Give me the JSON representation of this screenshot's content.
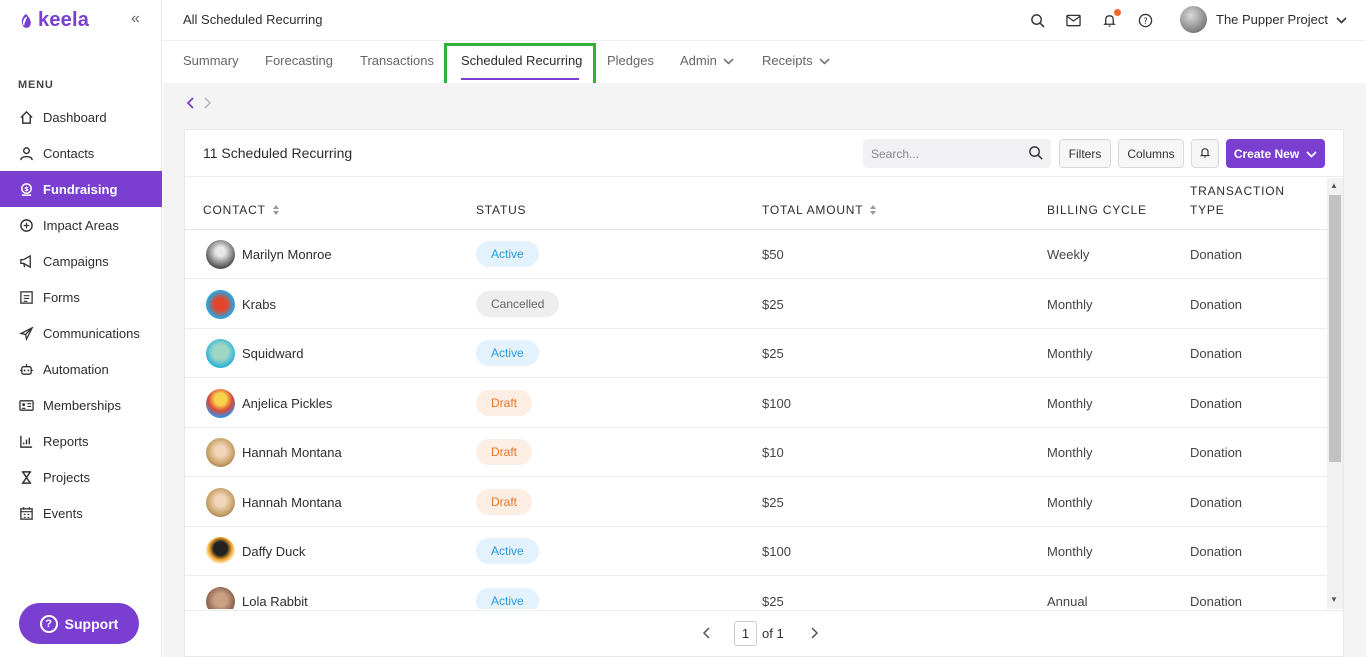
{
  "app": {
    "logo_text": "keela",
    "accent": "#7a3fd1"
  },
  "sidebar": {
    "menu_title": "MENU",
    "items": [
      {
        "label": "Dashboard",
        "icon": "home-icon",
        "active": false
      },
      {
        "label": "Contacts",
        "icon": "user-icon",
        "active": false
      },
      {
        "label": "Fundraising",
        "icon": "fundraising-icon",
        "active": true
      },
      {
        "label": "Impact Areas",
        "icon": "impact-icon",
        "active": false
      },
      {
        "label": "Campaigns",
        "icon": "megaphone-icon",
        "active": false
      },
      {
        "label": "Forms",
        "icon": "form-icon",
        "active": false
      },
      {
        "label": "Communications",
        "icon": "send-icon",
        "active": false
      },
      {
        "label": "Automation",
        "icon": "robot-icon",
        "active": false
      },
      {
        "label": "Memberships",
        "icon": "id-card-icon",
        "active": false
      },
      {
        "label": "Reports",
        "icon": "report-icon",
        "active": false
      },
      {
        "label": "Projects",
        "icon": "hourglass-icon",
        "active": false
      },
      {
        "label": "Events",
        "icon": "calendar-icon",
        "active": false
      }
    ],
    "support_label": "Support"
  },
  "topbar": {
    "title": "All Scheduled Recurring",
    "org_name": "The Pupper Project"
  },
  "tabs": [
    {
      "label": "Summary"
    },
    {
      "label": "Forecasting"
    },
    {
      "label": "Transactions"
    },
    {
      "label": "Scheduled Recurring",
      "active": true
    },
    {
      "label": "Pledges"
    },
    {
      "label": "Admin"
    },
    {
      "label": "Receipts"
    }
  ],
  "panel": {
    "title": "11 Scheduled Recurring",
    "search_placeholder": "Search...",
    "filters_label": "Filters",
    "columns_label": "Columns",
    "create_label": "Create New"
  },
  "table": {
    "headers": {
      "contact": "CONTACT",
      "status": "STATUS",
      "total_amount": "TOTAL AMOUNT",
      "billing_cycle": "BILLING CYCLE",
      "transaction_type_1": "TRANSACTION",
      "transaction_type_2": "TYPE"
    },
    "rows": [
      {
        "contact": "Marilyn Monroe",
        "status": "Active",
        "amount": "$50",
        "cycle": "Weekly",
        "type": "Donation"
      },
      {
        "contact": "Krabs",
        "status": "Cancelled",
        "amount": "$25",
        "cycle": "Monthly",
        "type": "Donation"
      },
      {
        "contact": "Squidward",
        "status": "Active",
        "amount": "$25",
        "cycle": "Monthly",
        "type": "Donation"
      },
      {
        "contact": "Anjelica Pickles",
        "status": "Draft",
        "amount": "$100",
        "cycle": "Monthly",
        "type": "Donation"
      },
      {
        "contact": "Hannah Montana",
        "status": "Draft",
        "amount": "$10",
        "cycle": "Monthly",
        "type": "Donation"
      },
      {
        "contact": "Hannah Montana",
        "status": "Draft",
        "amount": "$25",
        "cycle": "Monthly",
        "type": "Donation"
      },
      {
        "contact": "Daffy Duck",
        "status": "Active",
        "amount": "$100",
        "cycle": "Monthly",
        "type": "Donation"
      },
      {
        "contact": "Lola Rabbit",
        "status": "Active",
        "amount": "$25",
        "cycle": "Annual",
        "type": "Donation"
      }
    ]
  },
  "pagination": {
    "current_page": "1",
    "of_label": "of 1"
  }
}
